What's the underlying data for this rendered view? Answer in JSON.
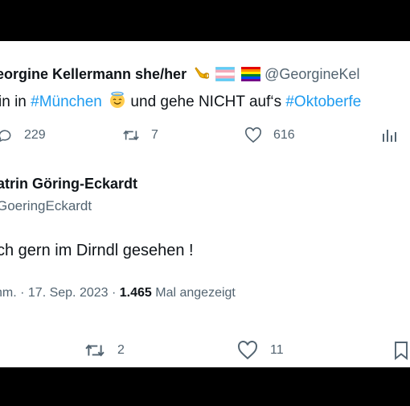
{
  "tweet1": {
    "author_name": "eorgine Kellermann she/her",
    "author_handle": "@GeorgineKel",
    "text_prefix": "in in ",
    "hashtag1": "#München",
    "text_mid": " und gehe NICHT auf‘s ",
    "hashtag2": "#Oktoberfe",
    "replies": "229",
    "retweets": "7",
    "likes": "616",
    "icons": [
      "horn-emoji",
      "trans-flag-emoji",
      "rainbow-flag-emoji",
      "smiling-halo-emoji"
    ]
  },
  "tweet2": {
    "author_name": "atrin Göring-Eckardt",
    "author_handle": "GoeringEckardt",
    "text": "ch gern im Dirndl gesehen !",
    "timestamp": "hm. · 17. Sep. 2023 · ",
    "views_count": "1.465",
    "views_label": " Mal angezeigt",
    "retweets": "2",
    "likes": "11"
  },
  "colors": {
    "background": "#000000",
    "card": "#ffffff",
    "text": "#0f1419",
    "secondary": "#536471",
    "hashtag": "#1d9bf0"
  }
}
